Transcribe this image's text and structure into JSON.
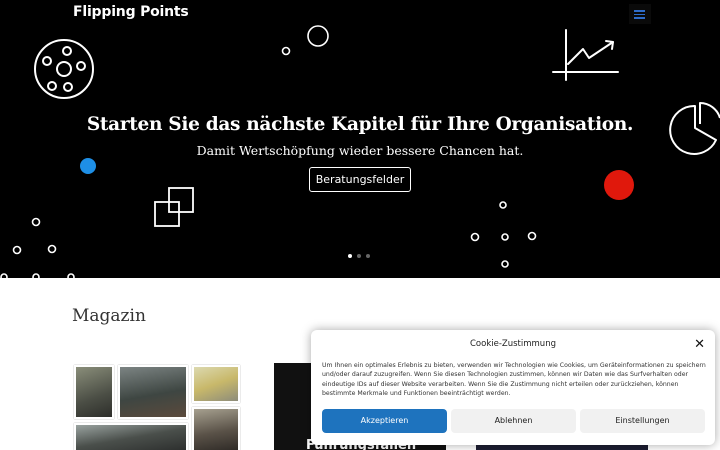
{
  "header": {
    "brand": "Flipping Points",
    "menu_icon": "hamburger-menu-icon",
    "accent": "#2e6cc9"
  },
  "hero": {
    "title": "Starten Sie das nächste Kapitel für Ihre Organisation.",
    "subtitle": "Damit Wertschöpfung wieder bessere Chancen hat.",
    "cta_label": "Beratungsfelder",
    "slider_total": 3,
    "slider_active": 1,
    "colors": {
      "background": "#000000",
      "blue_dot": "#1e8fe6",
      "red_dot": "#e0180c"
    }
  },
  "magazin": {
    "title": "Magazin",
    "card2_title": "Führungsfallen"
  },
  "cookie": {
    "title": "Cookie-Zustimmung",
    "text": "Um Ihnen ein optimales Erlebnis zu bieten, verwenden wir Technologien wie Cookies, um Geräteinformationen zu speichern und/oder darauf zuzugreifen. Wenn Sie diesen Technologien zustimmen, können wir Daten wie das Surfverhalten oder eindeutige IDs auf dieser Website verarbeiten. Wenn Sie die Zustimmung nicht erteilen oder zurückziehen, können bestimmte Merkmale und Funktionen beeinträchtigt werden.",
    "accept_label": "Akzeptieren",
    "deny_label": "Ablehnen",
    "settings_label": "Einstellungen",
    "close_symbol": "✕",
    "accent": "#1e73be"
  }
}
